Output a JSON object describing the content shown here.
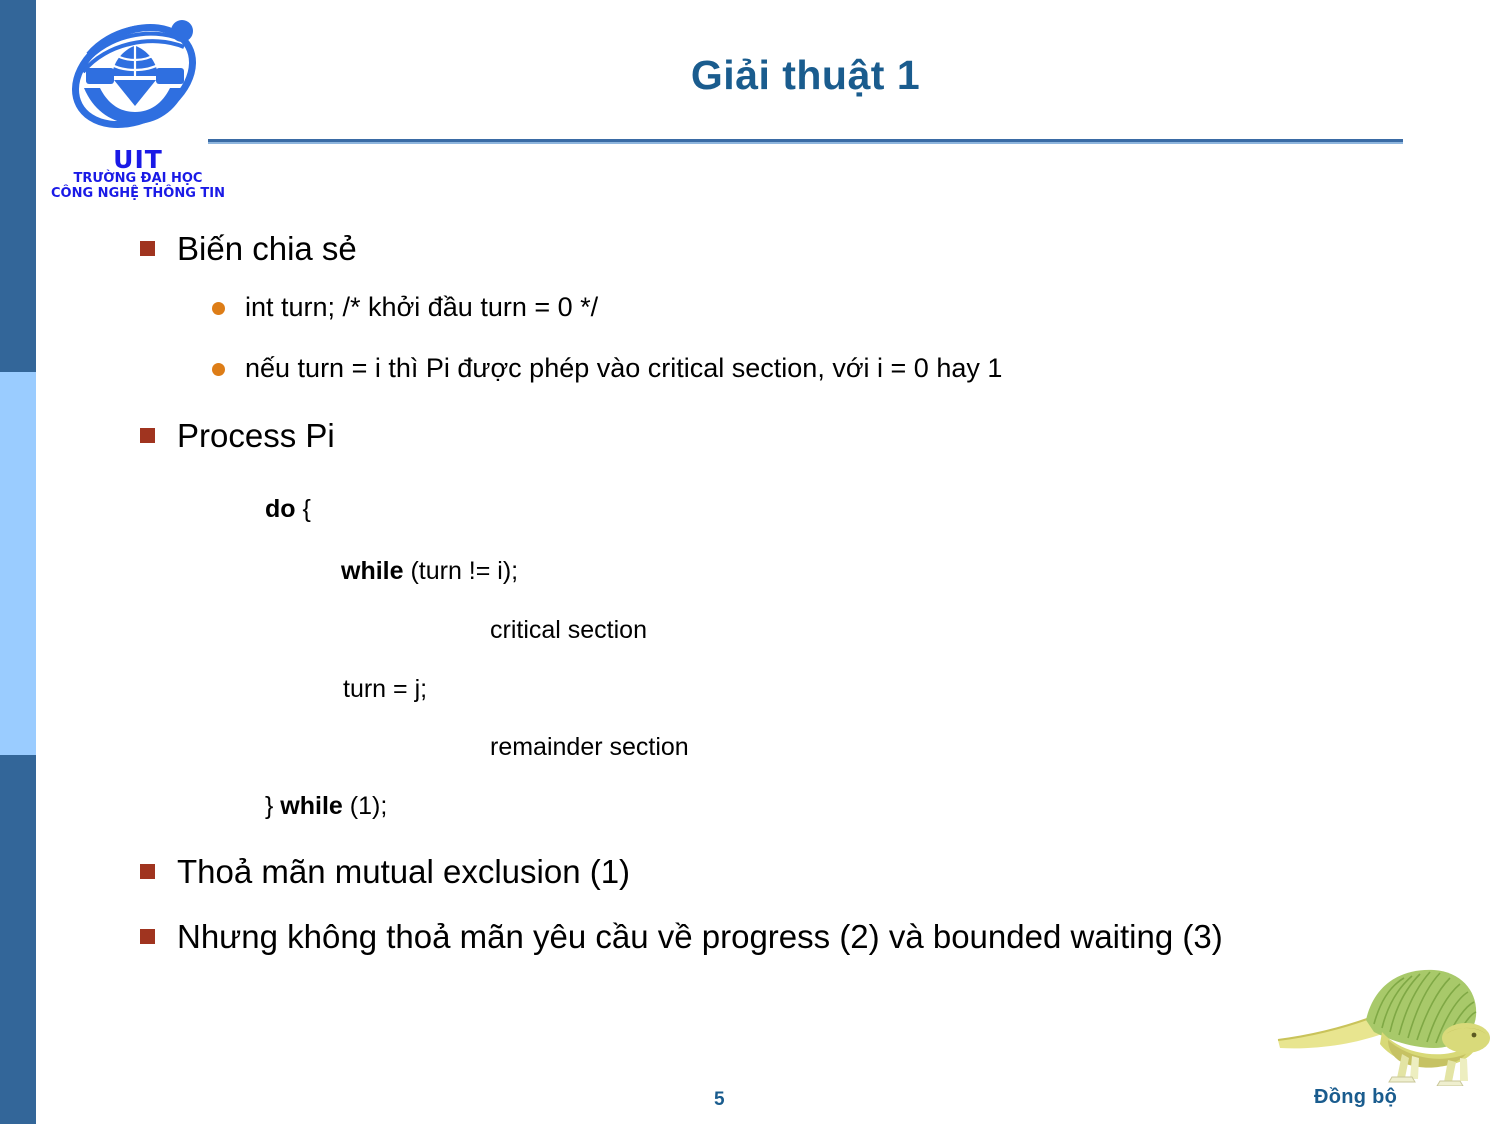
{
  "slide": {
    "page_number": "5",
    "title": "Giải thuật 1",
    "accent_title_color": "#1A5C8E",
    "bullet_square_color": "#A0341F",
    "bullet_dot_color": "#DD7D17",
    "sidebar_dark_color": "#336699",
    "sidebar_light_color": "#9ACCFF"
  },
  "logo": {
    "acronym": "UIT",
    "line1": "TRƯỜNG ĐẠI HỌC",
    "line2": "CÔNG NGHỆ THÔNG TIN",
    "color": "#1A1AE6"
  },
  "content": {
    "bullet1": "Biến chia sẻ",
    "sub1": "int   turn;                        /* khởi đầu turn = 0 */",
    "sub2": "nếu turn = i thì Pi  được phép vào critical section, với i = 0 hay 1",
    "bullet2": "Process Pi",
    "code": {
      "line1_bold": "do",
      "line1_rest": " {",
      "line2_bold": "while",
      "line2_rest": " (turn != i);",
      "line3": "critical section",
      "line4": "turn = j;",
      "line5": "remainder section",
      "line6_pre": "} ",
      "line6_bold": "while",
      "line6_rest": " (1);"
    },
    "bullet3": "Thoả mãn mutual exclusion (1)",
    "bullet4": "Nhưng không thoả mãn yêu cầu về progress (2) và bounded waiting (3)"
  },
  "footer": {
    "caption": "Đồng bộ",
    "caption_color": "#1A5C8E"
  }
}
